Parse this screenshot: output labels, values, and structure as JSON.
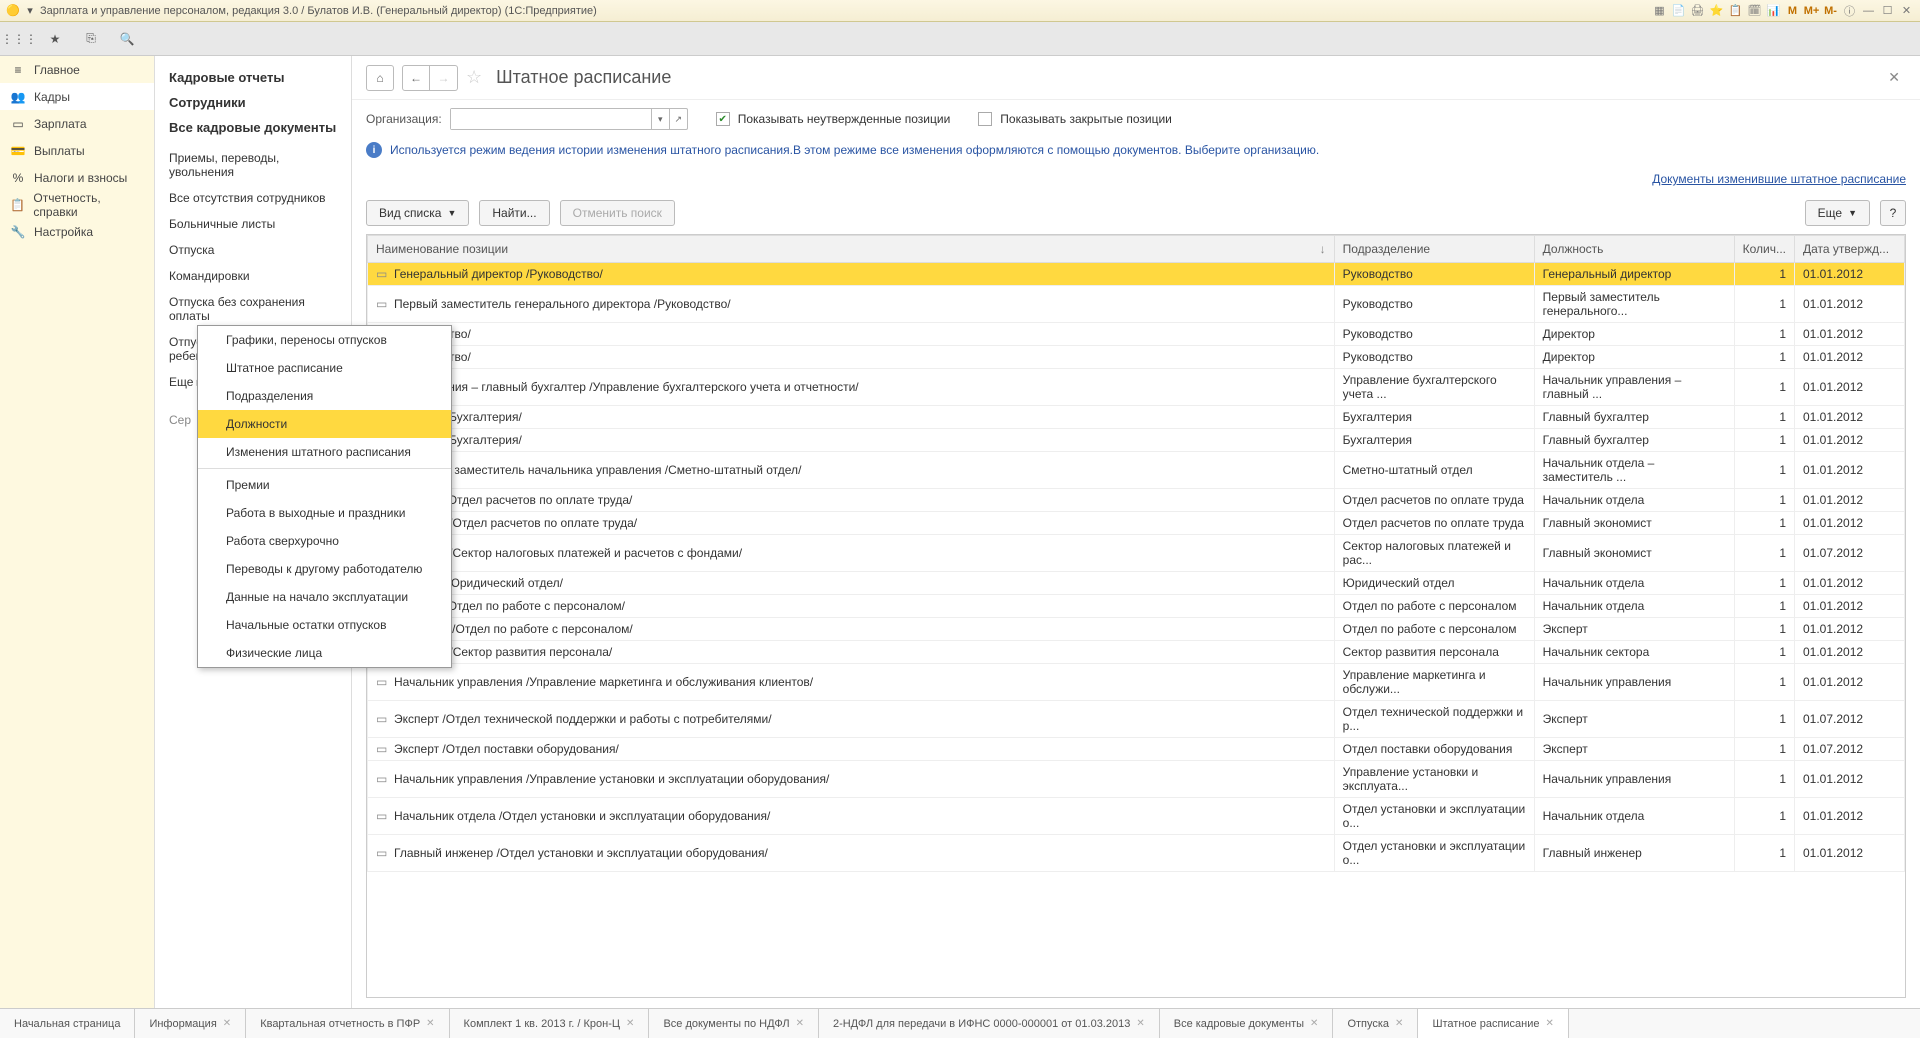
{
  "titlebar": {
    "text": "Зарплата и управление персоналом, редакция 3.0 / Булатов И.В. (Генеральный директор)  (1С:Предприятие)",
    "right_m": "M",
    "right_mp": "M+",
    "right_mm": "M-"
  },
  "nav": [
    {
      "label": "Главное",
      "icon": "≡"
    },
    {
      "label": "Кадры",
      "icon": "👥",
      "active": true
    },
    {
      "label": "Зарплата",
      "icon": "▭"
    },
    {
      "label": "Выплаты",
      "icon": "💳"
    },
    {
      "label": "Налоги и взносы",
      "icon": "%"
    },
    {
      "label": "Отчетность, справки",
      "icon": "📋"
    },
    {
      "label": "Настройка",
      "icon": "🔧"
    }
  ],
  "sub": {
    "headers": [
      "Кадровые отчеты",
      "Сотрудники",
      "Все кадровые документы"
    ],
    "items": [
      "Приемы, переводы, увольнения",
      "Все отсутствия сотрудников",
      "Больничные листы",
      "Отпуска",
      "Командировки",
      "Отпуска без сохранения оплаты",
      "Отпуска по уходу за ребенком"
    ],
    "more_label": "Еще  ▸",
    "service_label": "Сер"
  },
  "popup": {
    "items": [
      "Графики, переносы отпусков",
      "Штатное расписание",
      "Подразделения",
      "Должности",
      "Изменения штатного расписания",
      "Премии",
      "Работа в выходные и праздники",
      "Работа сверхурочно",
      "Переводы к другому работодателю",
      "Данные на начало эксплуатации",
      "Начальные остатки отпусков",
      "Физические лица"
    ],
    "highlight_index": 3,
    "sep_after": [
      4
    ]
  },
  "page": {
    "title": "Штатное расписание",
    "org_label": "Организация:",
    "chk1_label": "Показывать неутвержденные позиции",
    "chk2_label": "Показывать закрытые позиции",
    "info_text": "Используется режим ведения истории изменения штатного расписания.В этом режиме все изменения оформляются с помощью документов. Выберите организацию.",
    "link_text": "Документы изменившие штатное расписание",
    "btn_view": "Вид списка",
    "btn_find": "Найти...",
    "btn_cancel": "Отменить поиск",
    "btn_more": "Еще",
    "btn_help": "?"
  },
  "table": {
    "cols": [
      "Наименование позиции",
      "Подразделение",
      "Должность",
      "Колич...",
      "Дата утвержд..."
    ],
    "rows": [
      {
        "name": "Генеральный директор /Руководство/",
        "dept": "Руководство",
        "pos": "Генеральный директор",
        "qty": "1",
        "date": "01.01.2012",
        "sel": true
      },
      {
        "name": "Первый заместитель генерального директора /Руководство/",
        "dept": "Руководство",
        "pos": "Первый заместитель генерального...",
        "qty": "1",
        "date": "01.01.2012"
      },
      {
        "name": "/Руководство/",
        "dept": "Руководство",
        "pos": "Директор",
        "qty": "1",
        "date": "01.01.2012"
      },
      {
        "name": "/Руководство/",
        "dept": "Руководство",
        "pos": "Директор",
        "qty": "1",
        "date": "01.01.2012"
      },
      {
        "name": "к управления – главный бухгалтер /Управление бухгалтерского учета и отчетности/",
        "dept": "Управление бухгалтерского учета ...",
        "pos": "Начальник управления – главный ...",
        "qty": "1",
        "date": "01.01.2012"
      },
      {
        "name": "ухгалтер /Бухгалтерия/",
        "dept": "Бухгалтерия",
        "pos": "Главный бухгалтер",
        "qty": "1",
        "date": "01.01.2012"
      },
      {
        "name": "ухгалтер /Бухгалтерия/",
        "dept": "Бухгалтерия",
        "pos": "Главный бухгалтер",
        "qty": "1",
        "date": "01.01.2012"
      },
      {
        "name": "к отдела – заместитель начальника управления /Сметно-штатный отдел/",
        "dept": "Сметно-штатный отдел",
        "pos": "Начальник отдела – заместитель ...",
        "qty": "1",
        "date": "01.01.2012"
      },
      {
        "name": "к отдела /Отдел расчетов по оплате труда/",
        "dept": "Отдел расчетов по оплате труда",
        "pos": "Начальник отдела",
        "qty": "1",
        "date": "01.01.2012"
      },
      {
        "name": "кономист /Отдел расчетов по оплате труда/",
        "dept": "Отдел расчетов по оплате труда",
        "pos": "Главный экономист",
        "qty": "1",
        "date": "01.01.2012"
      },
      {
        "name": "кономист /Сектор налоговых платежей и расчетов с фондами/",
        "dept": "Сектор налоговых платежей и рас...",
        "pos": "Главный экономист",
        "qty": "1",
        "date": "01.07.2012"
      },
      {
        "name": "к отдела /Юридический отдел/",
        "dept": "Юридический отдел",
        "pos": "Начальник отдела",
        "qty": "1",
        "date": "01.01.2012"
      },
      {
        "name": "к отдела /Отдел по работе с персоналом/",
        "dept": "Отдел по работе с персоналом",
        "pos": "Начальник отдела",
        "qty": "1",
        "date": "01.01.2012"
      },
      {
        "name": "категории /Отдел по работе с персоналом/",
        "dept": "Отдел по работе с персоналом",
        "pos": "Эксперт",
        "qty": "1",
        "date": "01.01.2012"
      },
      {
        "name": "к сектора /Сектор развития персонала/",
        "dept": "Сектор развития персонала",
        "pos": "Начальник сектора",
        "qty": "1",
        "date": "01.01.2012"
      },
      {
        "name": "Начальник управления /Управление маркетинга и обслуживания клиентов/",
        "dept": "Управление маркетинга и обслужи...",
        "pos": "Начальник управления",
        "qty": "1",
        "date": "01.01.2012"
      },
      {
        "name": "Эксперт /Отдел технической поддержки и работы с потребителями/",
        "dept": "Отдел технической поддержки и р...",
        "pos": "Эксперт",
        "qty": "1",
        "date": "01.07.2012"
      },
      {
        "name": "Эксперт /Отдел поставки оборудования/",
        "dept": "Отдел поставки оборудования",
        "pos": "Эксперт",
        "qty": "1",
        "date": "01.07.2012"
      },
      {
        "name": "Начальник управления /Управление установки и эксплуатации оборудования/",
        "dept": "Управление установки и эксплуата...",
        "pos": "Начальник управления",
        "qty": "1",
        "date": "01.01.2012"
      },
      {
        "name": "Начальник отдела /Отдел установки и эксплуатации оборудования/",
        "dept": "Отдел установки и эксплуатации о...",
        "pos": "Начальник отдела",
        "qty": "1",
        "date": "01.01.2012"
      },
      {
        "name": "Главный инженер /Отдел установки и эксплуатации оборудования/",
        "dept": "Отдел установки и эксплуатации о...",
        "pos": "Главный инженер",
        "qty": "1",
        "date": "01.01.2012"
      }
    ]
  },
  "tabs": [
    "Начальная страница",
    "Информация",
    "Квартальная отчетность в ПФР",
    "Комплект 1 кв. 2013 г. / Крон-Ц",
    "Все документы по НДФЛ",
    "2-НДФЛ для передачи в ИФНС 0000-000001 от 01.03.2013",
    "Все кадровые документы",
    "Отпуска",
    "Штатное расписание"
  ],
  "active_tab": 8
}
